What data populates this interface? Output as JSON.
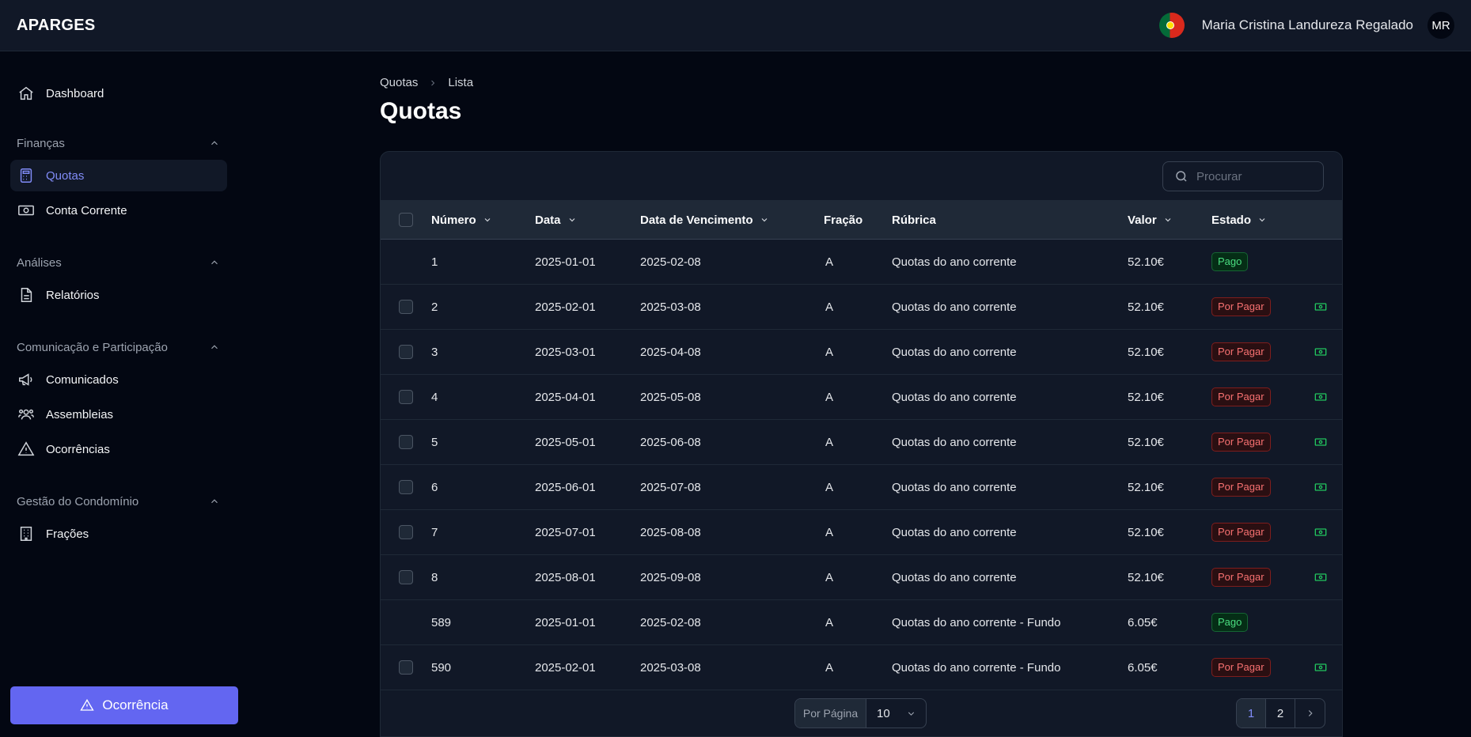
{
  "topbar": {
    "brand": "APARGES",
    "user_name": "Maria Cristina Landureza Regalado",
    "avatar_initials": "MR"
  },
  "sidebar": {
    "dashboard": "Dashboard",
    "groups": {
      "financas": "Finanças",
      "analises": "Análises",
      "comunicacao": "Comunicação e Participação",
      "gestao": "Gestão do Condomínio"
    },
    "items": {
      "quotas": "Quotas",
      "conta_corrente": "Conta Corrente",
      "relatorios": "Relatórios",
      "comunicados": "Comunicados",
      "assembleias": "Assembleias",
      "ocorrencias": "Ocorrências",
      "fracoes": "Frações"
    },
    "action_button": "Ocorrência"
  },
  "breadcrumb": {
    "root": "Quotas",
    "current": "Lista"
  },
  "page_title": "Quotas",
  "search": {
    "placeholder": "Procurar"
  },
  "table": {
    "headers": {
      "numero": "Número",
      "data": "Data",
      "vencimento": "Data de Vencimento",
      "fracao": "Fração",
      "rubrica": "Rúbrica",
      "valor": "Valor",
      "estado": "Estado"
    },
    "rows": [
      {
        "numero": "1",
        "data": "2025-01-01",
        "vencimento": "2025-02-08",
        "fracao": "A",
        "rubrica": "Quotas do ano corrente",
        "valor": "52.10€",
        "estado": "Pago",
        "paid": true
      },
      {
        "numero": "2",
        "data": "2025-02-01",
        "vencimento": "2025-03-08",
        "fracao": "A",
        "rubrica": "Quotas do ano corrente",
        "valor": "52.10€",
        "estado": "Por Pagar",
        "paid": false
      },
      {
        "numero": "3",
        "data": "2025-03-01",
        "vencimento": "2025-04-08",
        "fracao": "A",
        "rubrica": "Quotas do ano corrente",
        "valor": "52.10€",
        "estado": "Por Pagar",
        "paid": false
      },
      {
        "numero": "4",
        "data": "2025-04-01",
        "vencimento": "2025-05-08",
        "fracao": "A",
        "rubrica": "Quotas do ano corrente",
        "valor": "52.10€",
        "estado": "Por Pagar",
        "paid": false
      },
      {
        "numero": "5",
        "data": "2025-05-01",
        "vencimento": "2025-06-08",
        "fracao": "A",
        "rubrica": "Quotas do ano corrente",
        "valor": "52.10€",
        "estado": "Por Pagar",
        "paid": false
      },
      {
        "numero": "6",
        "data": "2025-06-01",
        "vencimento": "2025-07-08",
        "fracao": "A",
        "rubrica": "Quotas do ano corrente",
        "valor": "52.10€",
        "estado": "Por Pagar",
        "paid": false
      },
      {
        "numero": "7",
        "data": "2025-07-01",
        "vencimento": "2025-08-08",
        "fracao": "A",
        "rubrica": "Quotas do ano corrente",
        "valor": "52.10€",
        "estado": "Por Pagar",
        "paid": false
      },
      {
        "numero": "8",
        "data": "2025-08-01",
        "vencimento": "2025-09-08",
        "fracao": "A",
        "rubrica": "Quotas do ano corrente",
        "valor": "52.10€",
        "estado": "Por Pagar",
        "paid": false
      },
      {
        "numero": "589",
        "data": "2025-01-01",
        "vencimento": "2025-02-08",
        "fracao": "A",
        "rubrica": "Quotas do ano corrente - Fundo",
        "valor": "6.05€",
        "estado": "Pago",
        "paid": true
      },
      {
        "numero": "590",
        "data": "2025-02-01",
        "vencimento": "2025-03-08",
        "fracao": "A",
        "rubrica": "Quotas do ano corrente - Fundo",
        "valor": "6.05€",
        "estado": "Por Pagar",
        "paid": false
      }
    ]
  },
  "pagination": {
    "per_page_label": "Por Página",
    "per_page_value": "10",
    "pages": [
      "1",
      "2"
    ],
    "current_page": "1"
  },
  "colors": {
    "accent": "#6366f1",
    "paid": "#4ade80",
    "unpaid": "#f87171"
  },
  "icons": {
    "dashboard": "home-icon",
    "quotas": "calculator-icon",
    "conta_corrente": "banknote-icon",
    "relatorios": "document-icon",
    "comunicados": "megaphone-icon",
    "assembleias": "users-icon",
    "ocorrencias": "warning-icon",
    "fracoes": "building-icon",
    "pay_action": "cash-icon"
  }
}
